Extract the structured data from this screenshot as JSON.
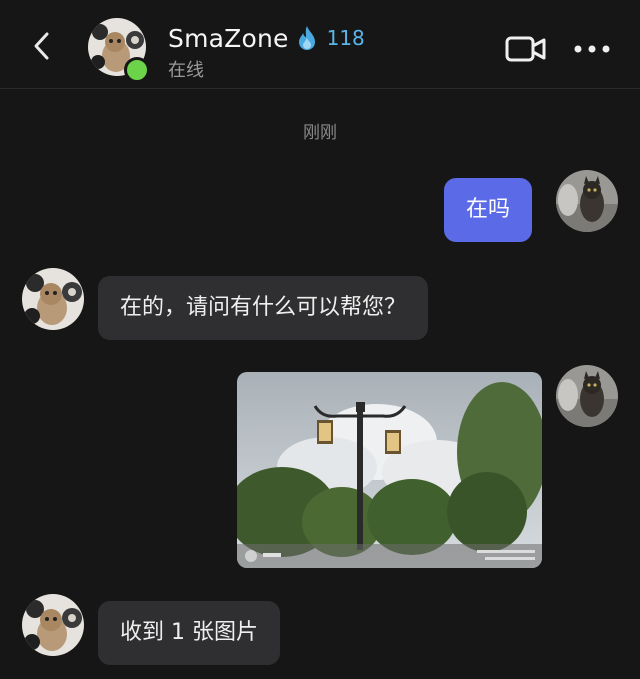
{
  "header": {
    "contact_name": "SmaZone",
    "streak_count": "118",
    "status": "在线",
    "icons": {
      "back": "chevron-left-icon",
      "flame": "flame-icon",
      "video": "video-call-icon",
      "more": "more-dots-icon"
    }
  },
  "chat": {
    "timestamp": "刚刚",
    "messages": [
      {
        "direction": "outgoing",
        "type": "text",
        "text": "在吗"
      },
      {
        "direction": "incoming",
        "type": "text",
        "text": "在的，请问有什么可以帮您？"
      },
      {
        "direction": "outgoing",
        "type": "image",
        "text": ""
      },
      {
        "direction": "incoming",
        "type": "text",
        "text": "收到 1 张图片"
      }
    ]
  },
  "colors": {
    "background": "#161616",
    "outgoing_bubble": "#5b6ae6",
    "incoming_bubble": "#2f2f31",
    "online": "#6bd44a",
    "streak": "#5bb5e8"
  }
}
